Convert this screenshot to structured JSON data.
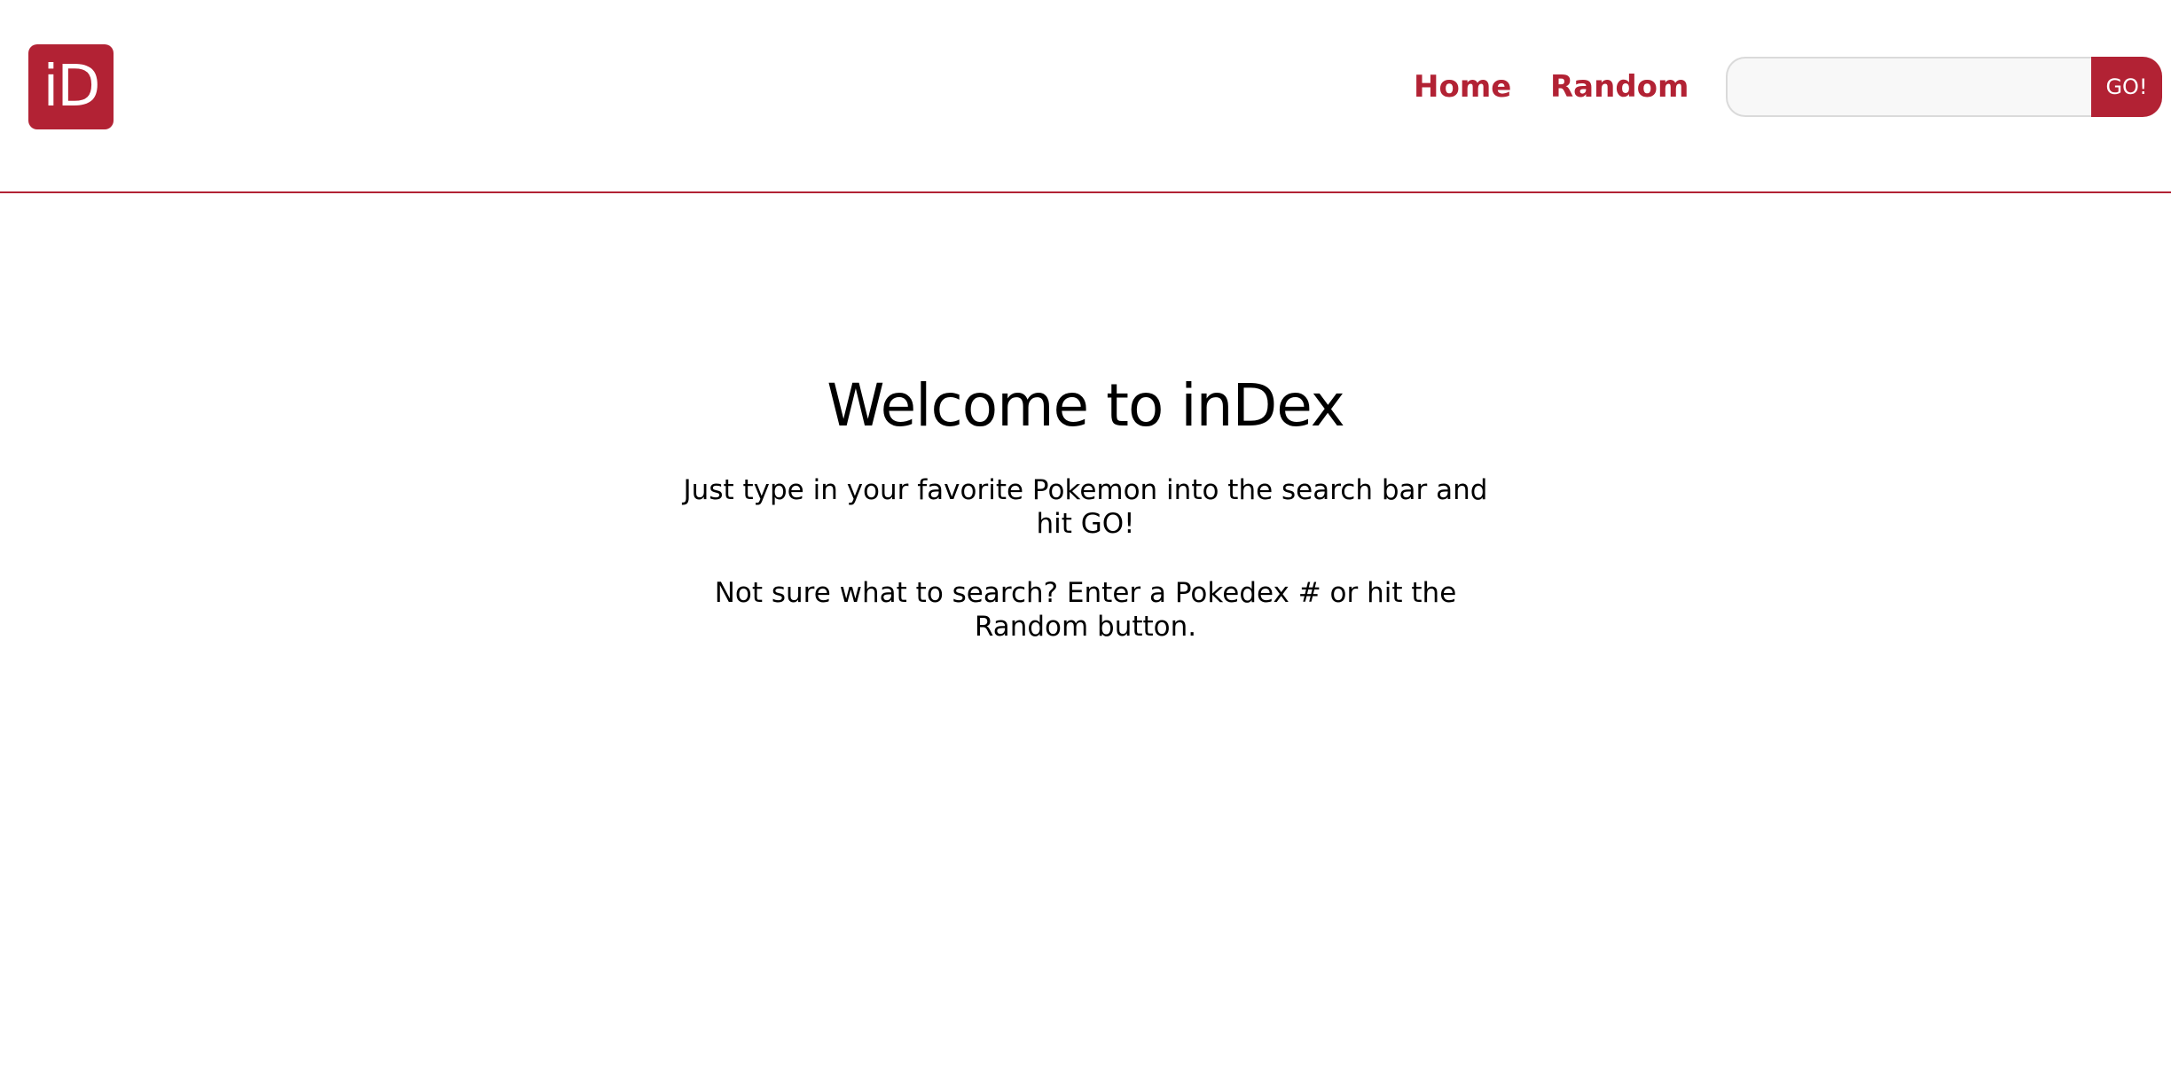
{
  "header": {
    "logo_text": "iD",
    "nav": {
      "home_label": "Home",
      "random_label": "Random"
    },
    "search": {
      "value": "",
      "placeholder": "",
      "button_label": "GO!"
    }
  },
  "main": {
    "title": "Welcome to inDex",
    "paragraph_1": "Just type in your favorite Pokemon into the search bar and hit GO!",
    "paragraph_2": "Not sure what to search? Enter a Pokedex # or hit the Random button."
  },
  "colors": {
    "accent": "#b22234",
    "background": "#ffffff",
    "text": "#000000",
    "input_background": "#f8f8f8",
    "input_border": "#dadada"
  }
}
